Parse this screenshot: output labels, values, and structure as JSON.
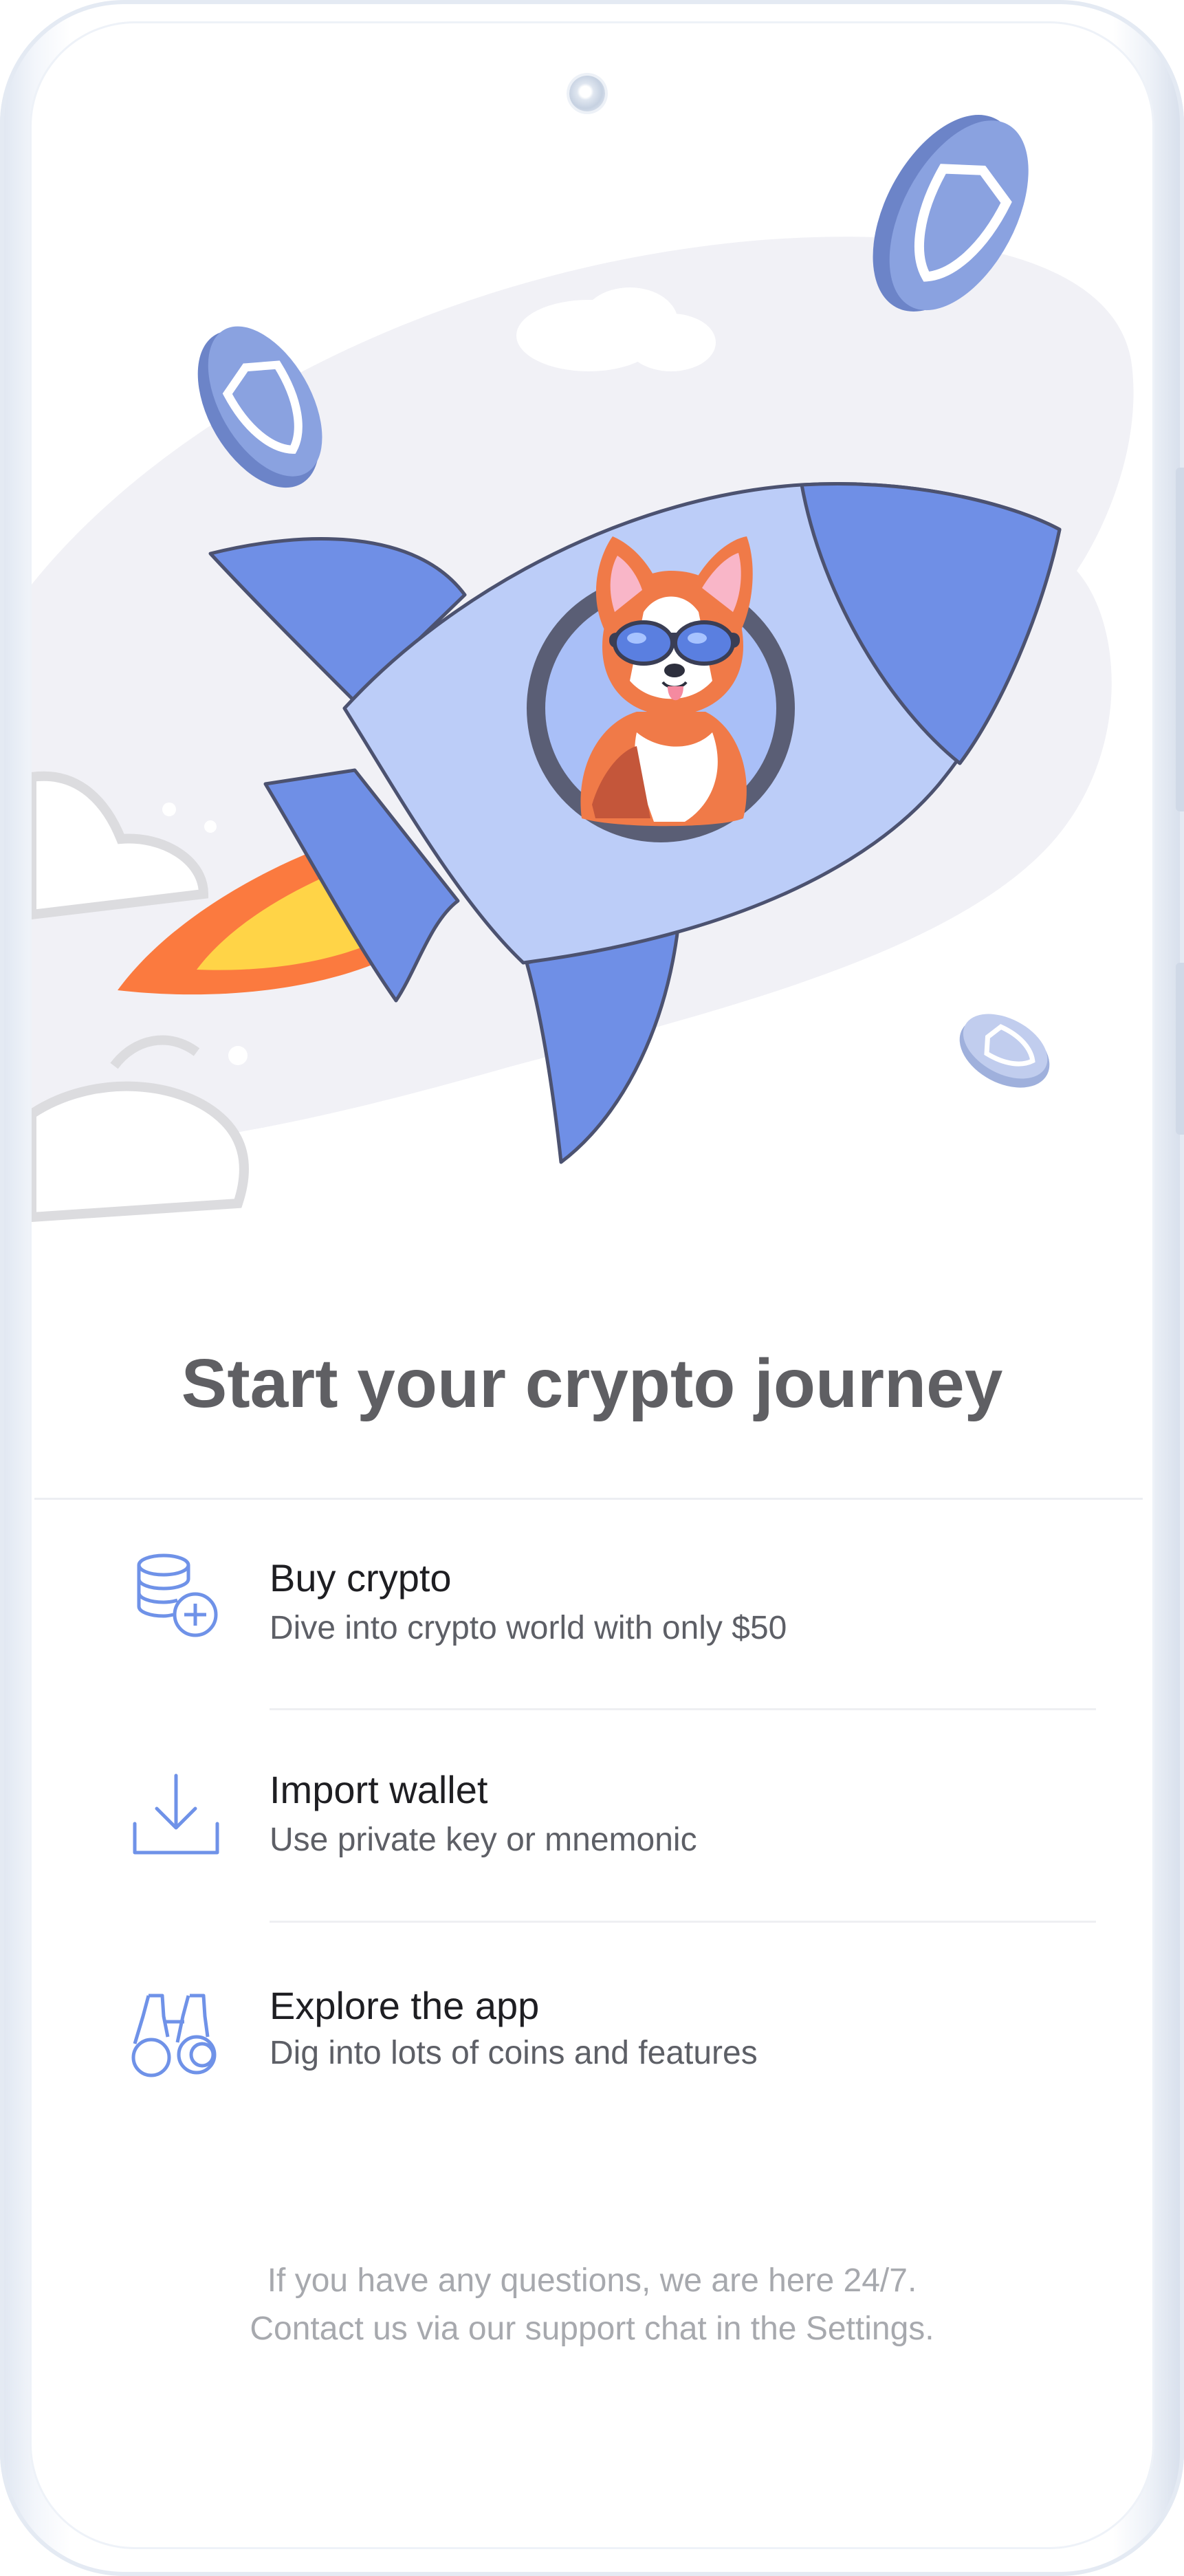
{
  "onboarding": {
    "title": "Start your crypto journey",
    "options": [
      {
        "label": "Buy crypto",
        "description": "Dive into crypto world with only $50",
        "icon": "coins-plus-icon"
      },
      {
        "label": "Import wallet",
        "description": "Use private key or mnemonic",
        "icon": "download-icon"
      },
      {
        "label": "Explore the app",
        "description": "Dig into lots of coins and features",
        "icon": "binoculars-icon"
      }
    ],
    "footer_line1": "If you have any questions, we are here 24/7.",
    "footer_line2": "Contact us via our support chat in the Settings."
  },
  "illustration": {
    "subject": "rocket-with-corgi-illustration",
    "coin_icon": "shield-coin-icon"
  },
  "colors": {
    "accent": "#5b80e6",
    "icon_stroke": "#6f92e8",
    "rocket_body": "#bccdf8",
    "rocket_fin": "#6f8fe6",
    "flame_outer": "#fb7a3f",
    "flame_inner": "#ffd447",
    "title": "#5f5f63",
    "footer": "#a7a9ae"
  }
}
